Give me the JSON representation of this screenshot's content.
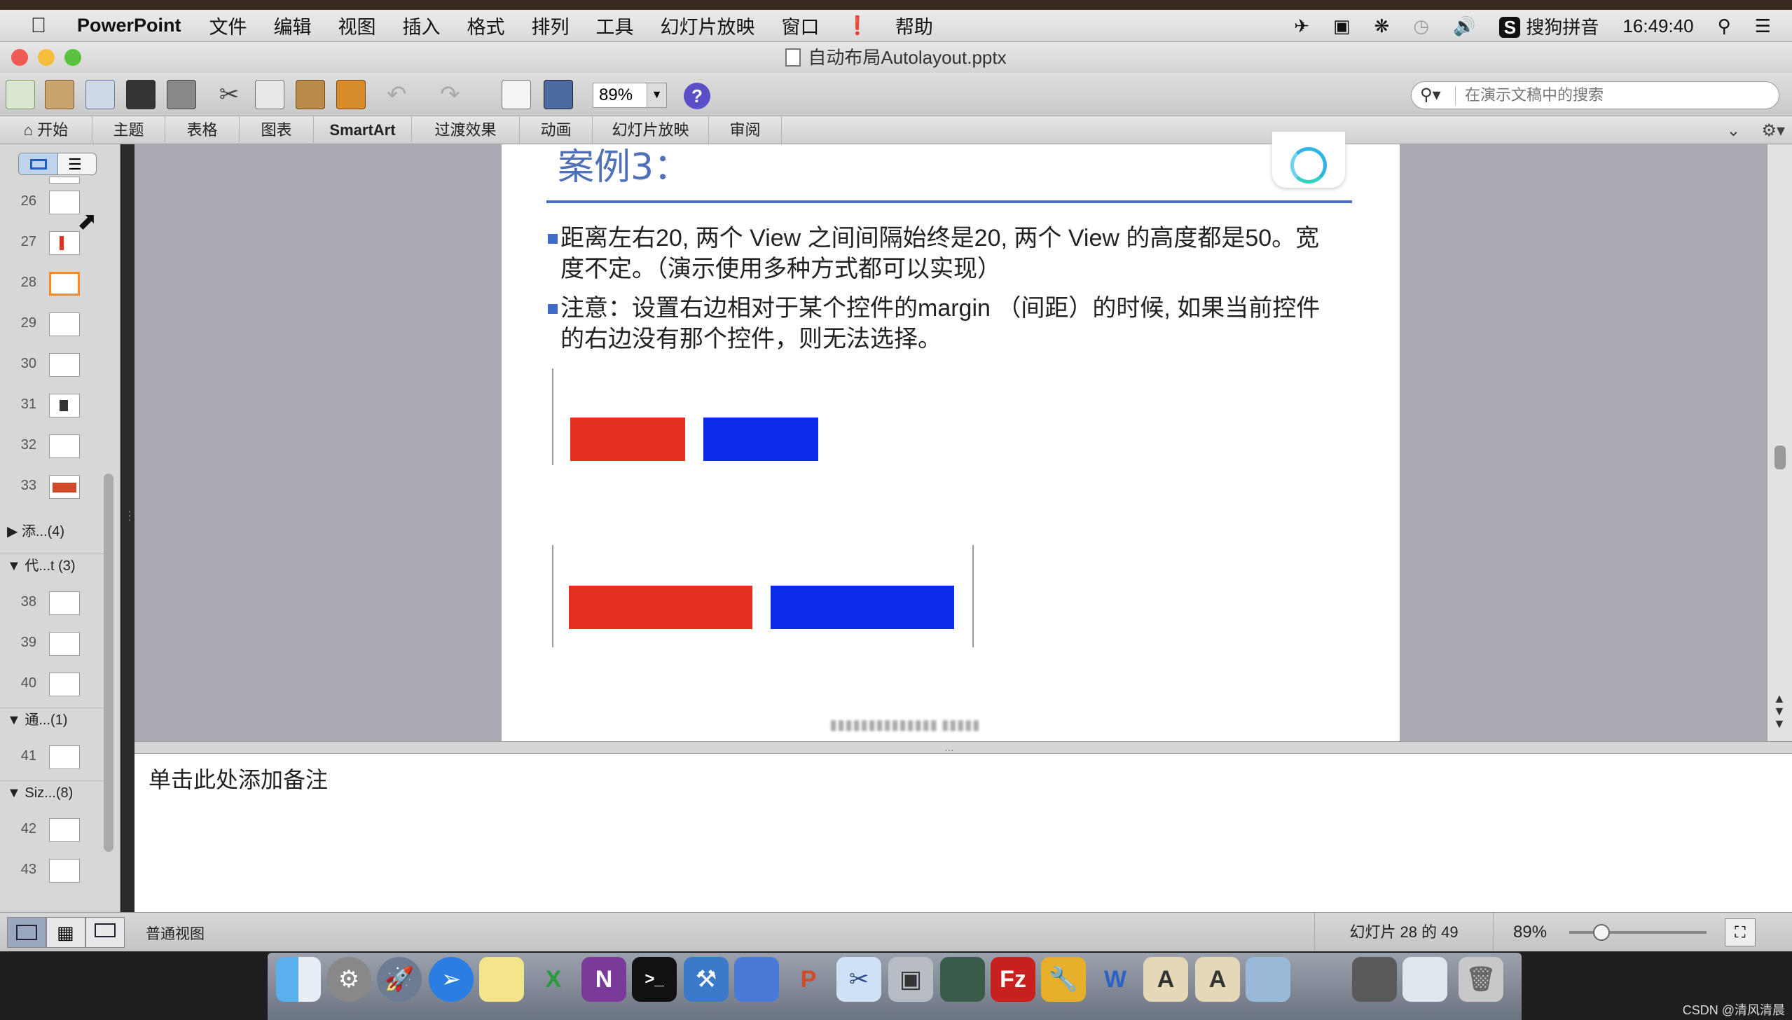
{
  "menubar": {
    "app_name": "PowerPoint",
    "items": [
      "文件",
      "编辑",
      "视图",
      "插入",
      "格式",
      "排列",
      "工具",
      "幻灯片放映",
      "窗口",
      "帮助"
    ],
    "input_method": "搜狗拼音",
    "time": "16:49:40"
  },
  "window": {
    "title": "自动布局Autolayout.pptx"
  },
  "toolbar": {
    "zoom_value": "89%",
    "help_label": "?",
    "search_placeholder": "在演示文稿中的搜索"
  },
  "ribbon": {
    "tabs": [
      "开始",
      "主题",
      "表格",
      "图表",
      "SmartArt",
      "过渡效果",
      "动画",
      "幻灯片放映",
      "审阅"
    ]
  },
  "slide_panel": {
    "slides": [
      {
        "num": "26"
      },
      {
        "num": "27"
      },
      {
        "num": "28"
      },
      {
        "num": "29"
      },
      {
        "num": "30"
      },
      {
        "num": "31"
      },
      {
        "num": "32"
      },
      {
        "num": "33"
      },
      {
        "num": "38"
      },
      {
        "num": "39"
      },
      {
        "num": "40"
      },
      {
        "num": "41"
      },
      {
        "num": "42"
      },
      {
        "num": "43"
      }
    ],
    "sections": [
      "添...(4)",
      "代...t (3)",
      "通...(1)",
      "Siz...(8)"
    ]
  },
  "slide": {
    "title": "案例3：",
    "bullets": [
      "距离左右20, 两个 View 之间间隔始终是20, 两个 View 的高度都是50。宽度不定。（演示使用多种方式都可以实现）",
      "注意：设置右边相对于某个控件的margin （间距）的时候, 如果当前控件的右边没有那个控件，则无法选择。"
    ],
    "colors": {
      "red": "#e5301f",
      "blue": "#0a2ce8",
      "title": "#5070b8",
      "rule": "#4a6fc3"
    }
  },
  "notes": {
    "placeholder": "单击此处添加备注"
  },
  "statusbar": {
    "view_name": "普通视图",
    "slide_counter": "幻灯片 28 的 49",
    "zoom": "89%"
  },
  "dock": {
    "icons": [
      "finder-icon",
      "system-preferences-icon",
      "launchpad-icon",
      "safari-icon",
      "notes-icon",
      "excel-icon",
      "onenote-icon",
      "terminal-icon",
      "xcode-icon",
      "preview-icon",
      "powerpoint-icon",
      "scissors-icon",
      "photo-slideshow-icon",
      "ftp-icon",
      "filezilla-icon",
      "wrench-icon",
      "word-icon",
      "text-editor-icon",
      "text-editor-2-icon",
      "image-viewer-icon",
      "projector-icon",
      "email-icon",
      "trash-icon"
    ]
  },
  "watermark": "CSDN @清风清晨"
}
